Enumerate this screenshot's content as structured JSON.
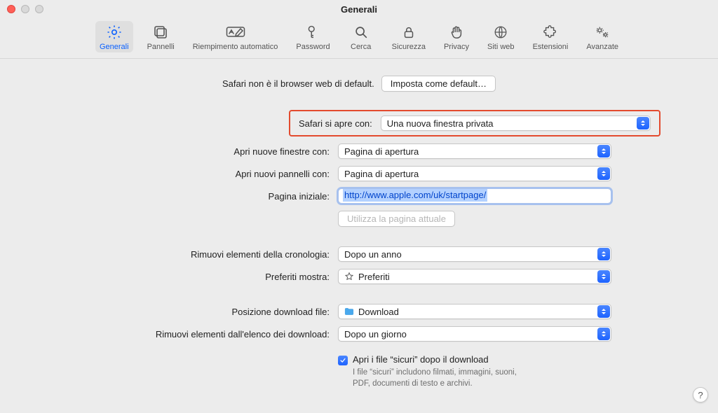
{
  "window": {
    "title": "Generali"
  },
  "toolbar": [
    {
      "id": "generali",
      "label": "Generali",
      "selected": true
    },
    {
      "id": "pannelli",
      "label": "Pannelli"
    },
    {
      "id": "riempimento",
      "label": "Riempimento automatico"
    },
    {
      "id": "password",
      "label": "Password"
    },
    {
      "id": "cerca",
      "label": "Cerca"
    },
    {
      "id": "sicurezza",
      "label": "Sicurezza"
    },
    {
      "id": "privacy",
      "label": "Privacy"
    },
    {
      "id": "sitiweb",
      "label": "Siti web"
    },
    {
      "id": "estensioni",
      "label": "Estensioni"
    },
    {
      "id": "avanzate",
      "label": "Avanzate"
    }
  ],
  "default_browser": {
    "message": "Safari non è il browser web di default.",
    "button": "Imposta come default…"
  },
  "rows": {
    "opens_with": {
      "label": "Safari si apre con:",
      "value": "Una nuova finestra privata"
    },
    "new_windows": {
      "label": "Apri nuove finestre con:",
      "value": "Pagina di apertura"
    },
    "new_tabs": {
      "label": "Apri nuovi pannelli con:",
      "value": "Pagina di apertura"
    },
    "homepage": {
      "label": "Pagina iniziale:",
      "value": "http://www.apple.com/uk/startpage/"
    },
    "use_current": {
      "button": "Utilizza la pagina attuale"
    },
    "history_remove": {
      "label": "Rimuovi elementi della cronologia:",
      "value": "Dopo un anno"
    },
    "favorites_show": {
      "label": "Preferiti mostra:",
      "value": "Preferiti"
    },
    "download_location": {
      "label": "Posizione download file:",
      "value": "Download"
    },
    "download_remove": {
      "label": "Rimuovi elementi dall'elenco dei download:",
      "value": "Dopo un giorno"
    }
  },
  "safe_files": {
    "checked": true,
    "label": "Apri i file “sicuri” dopo il download",
    "note": "I file “sicuri” includono filmati, immagini, suoni, PDF, documenti di testo e archivi."
  },
  "help": "?"
}
